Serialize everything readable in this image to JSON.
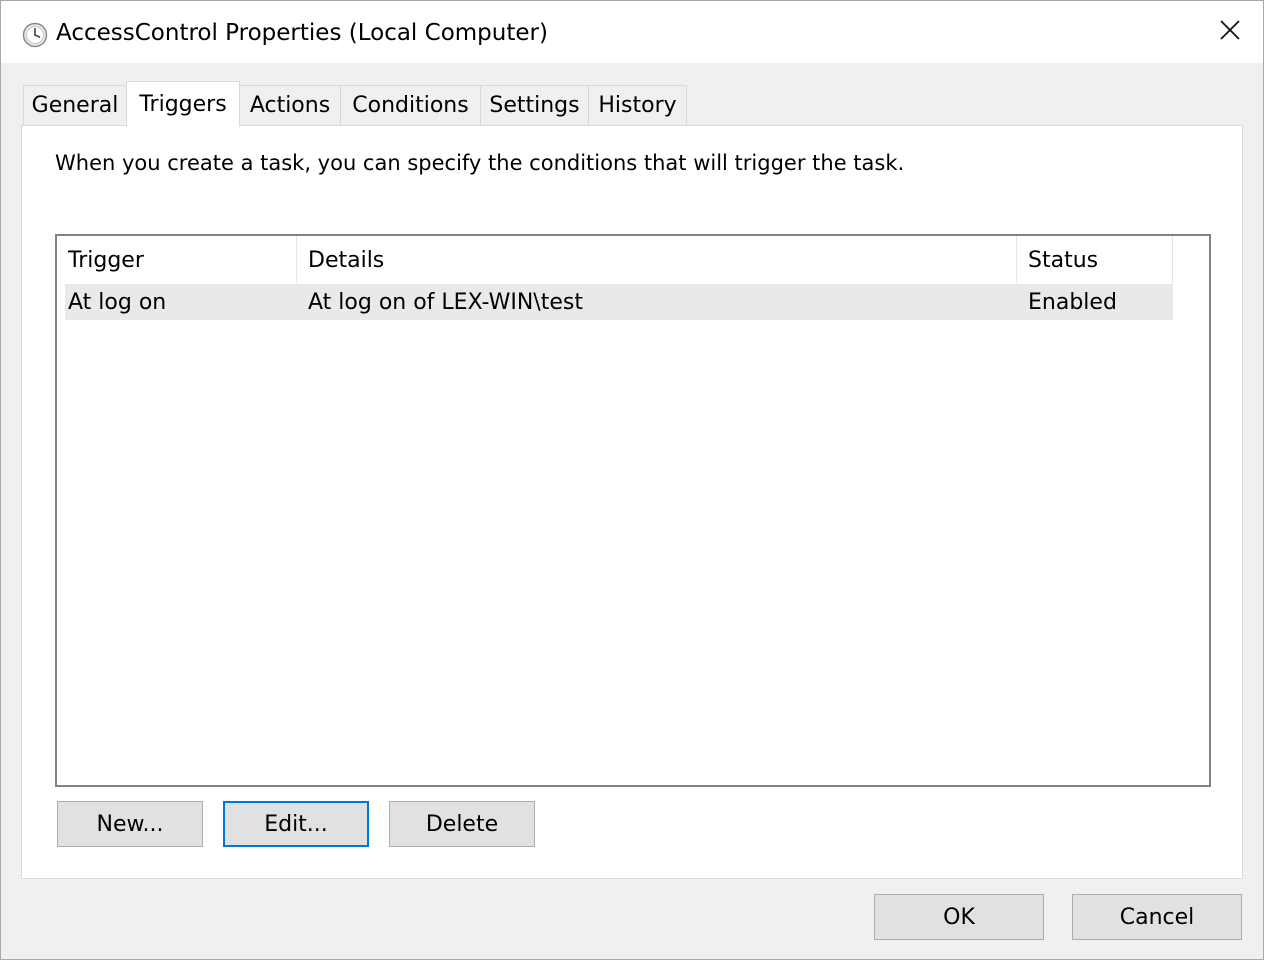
{
  "window": {
    "title": "AccessControl Properties (Local Computer)",
    "icon": "clock-icon",
    "close_glyph": "✕"
  },
  "tabs": [
    {
      "label": "General",
      "active": false
    },
    {
      "label": "Triggers",
      "active": true
    },
    {
      "label": "Actions",
      "active": false
    },
    {
      "label": "Conditions",
      "active": false
    },
    {
      "label": "Settings",
      "active": false
    },
    {
      "label": "History",
      "active": false
    }
  ],
  "triggers": {
    "description": "When you create a task, you can specify the conditions that will trigger the task.",
    "columns": [
      "Trigger",
      "Details",
      "Status"
    ],
    "rows": [
      {
        "trigger": "At log on",
        "details": "At log on of LEX-WIN\\test",
        "status": "Enabled"
      }
    ],
    "buttons": {
      "new_label": "New...",
      "edit_label": "Edit...",
      "delete_label": "Delete"
    }
  },
  "dialog_buttons": {
    "ok_label": "OK",
    "cancel_label": "Cancel"
  },
  "colors": {
    "focus_border": "#0078d7",
    "selected_row": "#e9e9e9",
    "chrome": "#f0f0f0"
  }
}
